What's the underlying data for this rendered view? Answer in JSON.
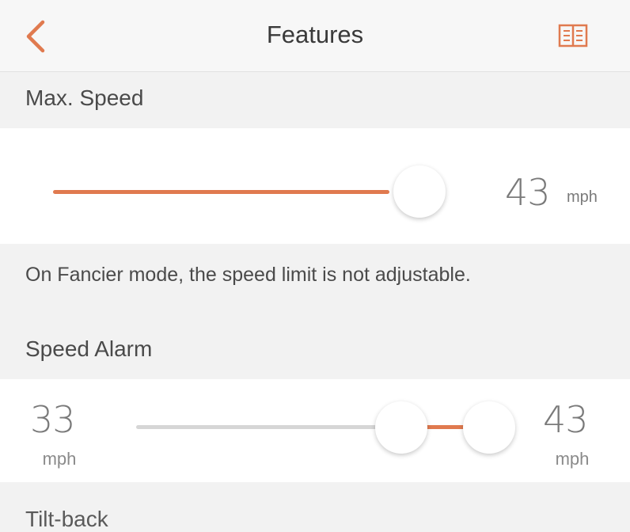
{
  "header": {
    "title": "Features",
    "back_icon": "chevron-left-icon",
    "manual_icon": "book-icon",
    "accent_color": "#e07a4f"
  },
  "max_speed": {
    "label": "Max. Speed",
    "value": "43",
    "unit": "mph",
    "level_fraction": 0.82,
    "note": "On Fancier mode, the speed limit is not adjustable."
  },
  "speed_alarm": {
    "label": "Speed Alarm",
    "low_value": "33",
    "low_unit": "mph",
    "high_value": "43",
    "high_unit": "mph"
  },
  "next_section": {
    "label": "Tilt-back"
  }
}
